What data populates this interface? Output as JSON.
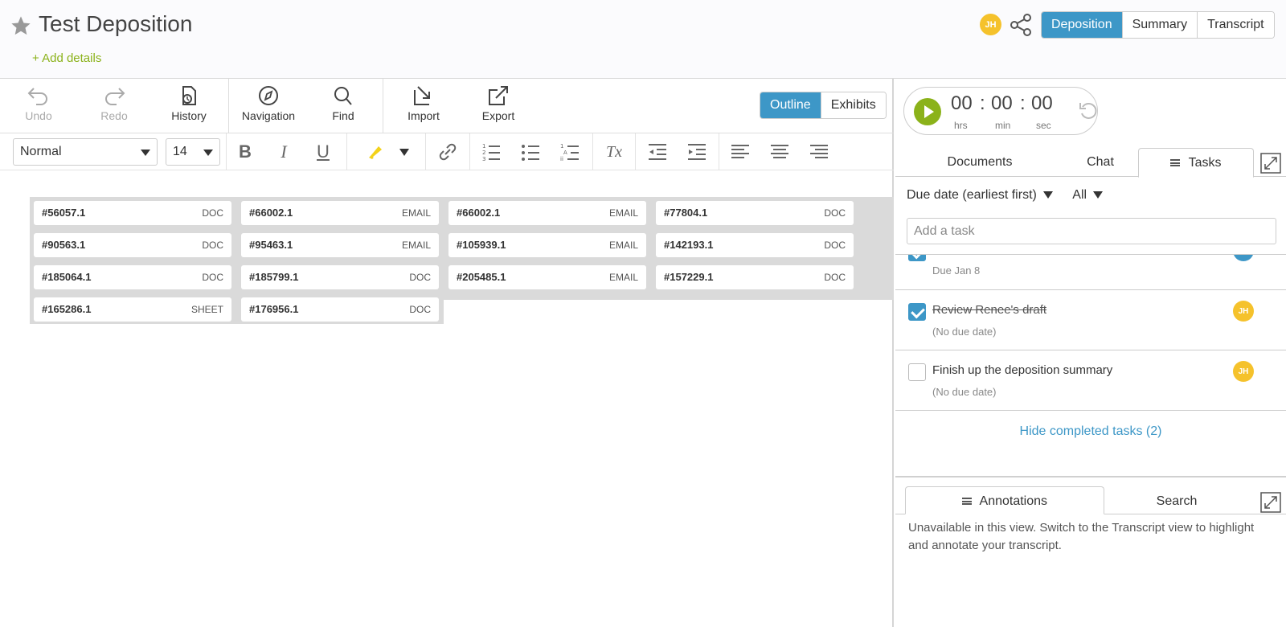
{
  "header": {
    "title": "Test Deposition",
    "add_details": "+ Add details",
    "avatar_initials": "JH",
    "view_tabs": [
      "Deposition",
      "Summary",
      "Transcript"
    ],
    "active_view": "Deposition"
  },
  "toolbar": {
    "undo": "Undo",
    "redo": "Redo",
    "history": "History",
    "navigation": "Navigation",
    "find": "Find",
    "import": "Import",
    "export": "Export",
    "outline": "Outline",
    "exhibits": "Exhibits"
  },
  "format_bar": {
    "style": "Normal",
    "size": "14",
    "bold": "B",
    "italic": "I",
    "underline": "U",
    "clear_format": "Tx"
  },
  "exhibit_chips": [
    {
      "id": "#56057.1",
      "type": "DOC"
    },
    {
      "id": "#66002.1",
      "type": "EMAIL"
    },
    {
      "id": "#66002.1",
      "type": "EMAIL"
    },
    {
      "id": "#77804.1",
      "type": "DOC"
    },
    {
      "id": "#90563.1",
      "type": "DOC"
    },
    {
      "id": "#95463.1",
      "type": "EMAIL"
    },
    {
      "id": "#105939.1",
      "type": "EMAIL"
    },
    {
      "id": "#142193.1",
      "type": "DOC"
    },
    {
      "id": "#185064.1",
      "type": "DOC"
    },
    {
      "id": "#185799.1",
      "type": "DOC"
    },
    {
      "id": "#205485.1",
      "type": "EMAIL"
    },
    {
      "id": "#157229.1",
      "type": "DOC"
    },
    {
      "id": "#165286.1",
      "type": "SHEET"
    },
    {
      "id": "#176956.1",
      "type": "DOC"
    }
  ],
  "timer": {
    "hours": "00",
    "minutes": "00",
    "seconds": "00",
    "sep": ":",
    "hrs_label": "hrs",
    "min_label": "min",
    "sec_label": "sec"
  },
  "panel_tabs": {
    "documents": "Documents",
    "chat": "Chat",
    "tasks": "Tasks"
  },
  "tasks": {
    "sort_label": "Due date (earliest first)",
    "filter_label": "All",
    "add_placeholder": "Add a task",
    "items": [
      {
        "name": "",
        "due": "Due Jan 8",
        "done": true
      },
      {
        "name": "Review Renee's draft",
        "due": "(No due date)",
        "done": true,
        "assignee": "JH"
      },
      {
        "name": "Finish up the deposition summary",
        "due": "(No due date)",
        "done": false,
        "assignee": "JH"
      }
    ],
    "hide_completed": "Hide completed tasks (2)"
  },
  "annotations": {
    "annotations_tab": "Annotations",
    "search_tab": "Search",
    "message": "Unavailable in this view. Switch to the Transcript view to highlight and annotate your transcript."
  },
  "colors": {
    "accent_blue": "#3d97c7",
    "accent_green": "#8bb21a",
    "avatar_yellow": "#f5c22c",
    "highlighter_yellow": "#f3d21a"
  }
}
